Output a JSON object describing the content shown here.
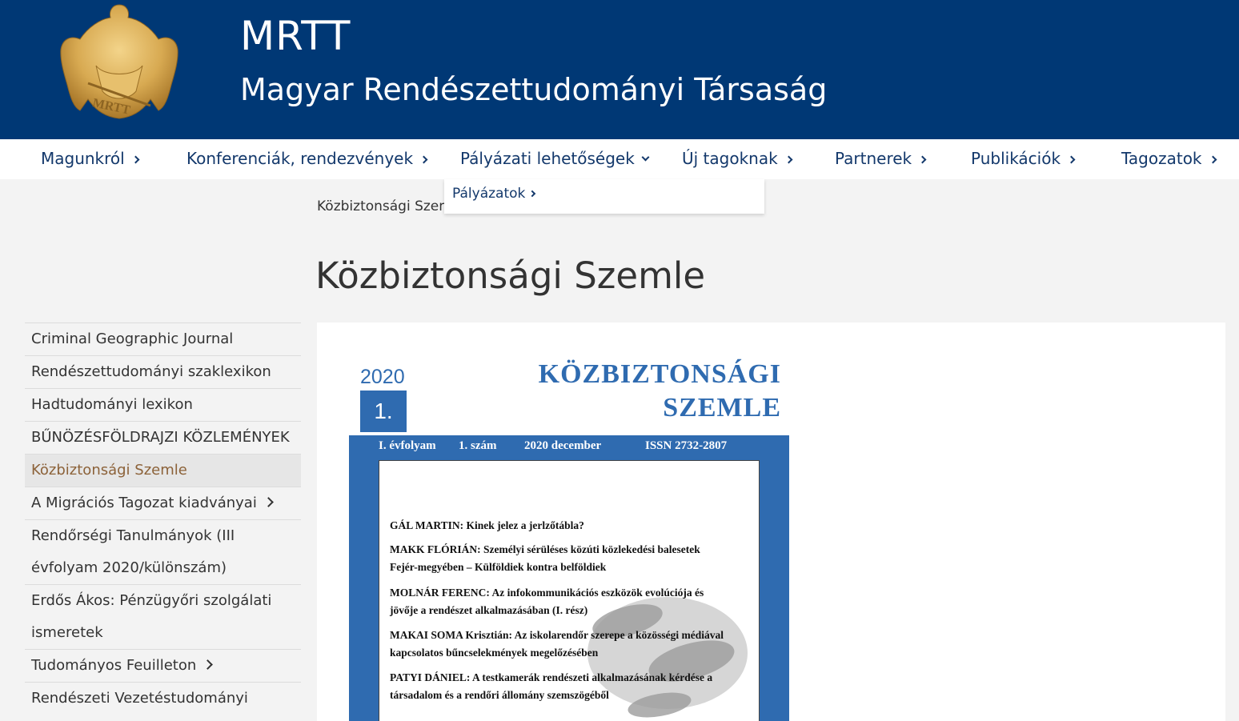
{
  "header": {
    "title": "MRTT",
    "subtitle": "Magyar Rendészettudományi Társaság",
    "logo_text": "MRTT"
  },
  "nav": {
    "items": [
      {
        "label": "Magunkról"
      },
      {
        "label": "Konferenciák, rendezvények"
      },
      {
        "label": "Pályázati lehetőségek"
      },
      {
        "label": "Új tagoknak"
      },
      {
        "label": "Partnerek"
      },
      {
        "label": "Publikációk"
      },
      {
        "label": "Tagozatok"
      }
    ],
    "dropdown": {
      "items": [
        {
          "label": "Pályázatok"
        }
      ]
    }
  },
  "breadcrumb": "Közbiztonsági Szemle",
  "page_title": "Közbiztonsági Szemle",
  "sidebar": {
    "items": [
      {
        "label": "Criminal Geographic Journal"
      },
      {
        "label": "Rendészettudományi szaklexikon"
      },
      {
        "label": "Hadtudományi lexikon"
      },
      {
        "label": "BŰNÖZÉSFÖLDRAJZI KÖZLEMÉNYEK"
      },
      {
        "label": "Közbiztonsági Szemle"
      },
      {
        "label": "A Migrációs Tagozat kiadványai"
      },
      {
        "label": "Rendőrségi Tanulmányok (III évfolyam 2020/különszám)"
      },
      {
        "label": "Erdős Ákos: Pénzügyőri szolgálati ismeretek"
      },
      {
        "label": "Tudományos Feuilleton"
      },
      {
        "label": "Rendészeti Vezetéstudományi Tanszék Konferenciakötete"
      }
    ]
  },
  "cover": {
    "year": "2020",
    "issue": "1.",
    "title_line1": "KÖZBIZTONSÁGI",
    "title_line2": "SZEMLE",
    "meta": {
      "volume": "I. évfolyam",
      "number": "1. szám",
      "date": "2020 december",
      "issn": "ISSN 2732-2807"
    },
    "toc": [
      {
        "line1": "GÁL MARTIN: Kinek jelez a jerlzőtábla?",
        "line2": ""
      },
      {
        "line1": "MAKK FLÓRIÁN: Személyi sérüléses közúti közlekedési balesetek",
        "line2": "Fejér-megyében – Külföldiek kontra belföldiek"
      },
      {
        "line1": "MOLNÁR FERENC: Az infokommunikációs eszközök evolúciója és",
        "line2": "jövője a rendészet alkalmazásában (I. rész)"
      },
      {
        "line1": "MAKAI SOMA Krisztián: Az iskolarendőr szerepe a közösségi médiával",
        "line2": "kapcsolatos bűncselekmények megelőzésében"
      },
      {
        "line1": "PATYI DÁNIEL: A testkamerák rendészeti alkalmazásának kérdése a",
        "line2": "társadalom és a rendőri állomány szemszögéből"
      }
    ]
  },
  "colors": {
    "header_bg": "#003875",
    "nav_text": "#13386b",
    "active_sidebar_text": "#8c6239",
    "cover_blue": "#2f6bb0"
  }
}
